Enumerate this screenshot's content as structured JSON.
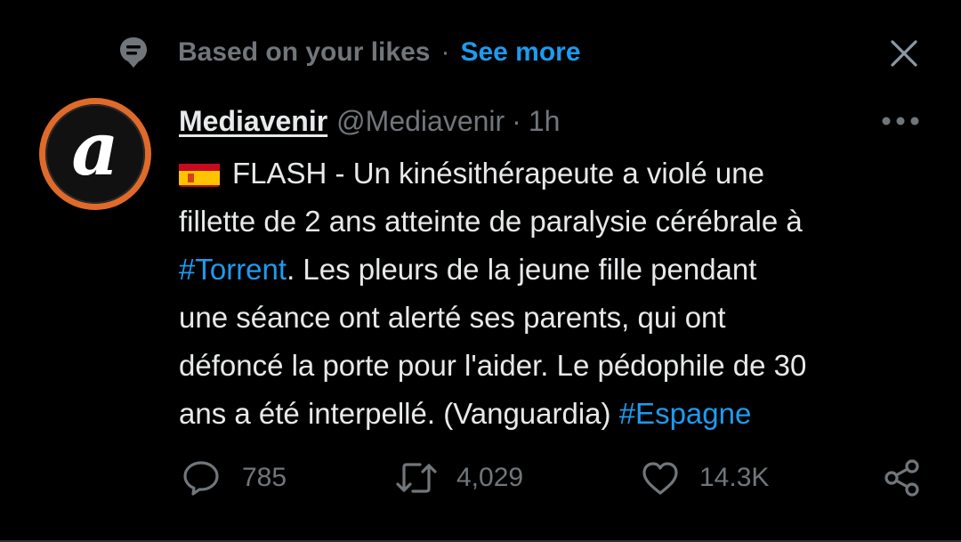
{
  "context": {
    "label": "Based on your likes",
    "separator": "·",
    "see_more": "See more",
    "icon": "speech-bubble-pin-icon"
  },
  "author": {
    "display_name": "Mediavenir",
    "handle": "@Mediavenir",
    "separator": "·",
    "time": "1h",
    "avatar_letter": "a",
    "avatar_ring_color": "#e06a2a"
  },
  "tweet": {
    "flag": "spain-flag-icon",
    "lines": [
      [
        "FLASH - Un kinésithérapeute a violé une"
      ],
      [
        "fillette de 2 ans atteinte de paralysie cérébrale à"
      ],
      [
        "#Torrent",
        ". Les pleurs de la jeune fille pendant"
      ],
      [
        "une séance ont alerté ses parents, qui ont"
      ],
      [
        "défoncé la porte pour l'aider. Le pédophile de 30"
      ],
      [
        "ans a été interpellé. (Vanguardia) ",
        "#Espagne"
      ]
    ]
  },
  "actions": {
    "reply_count": "785",
    "retweet_count": "4,029",
    "like_count": "14.3K"
  },
  "colors": {
    "background": "#000000",
    "text": "#e7e9ea",
    "muted": "#71767b",
    "accent": "#1d9bf0"
  }
}
